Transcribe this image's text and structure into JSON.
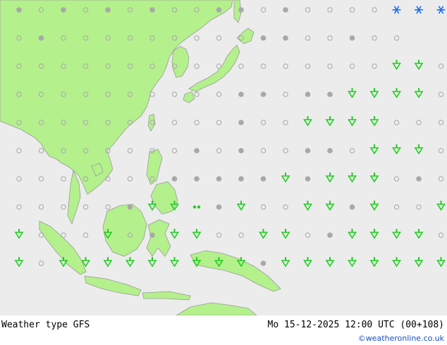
{
  "footer": {
    "left_label": "Weather type  GFS",
    "right_label": "Mo 15-12-2025 12:00 UTC (00+108)",
    "credit": "©weatheronline.co.uk"
  },
  "colors": {
    "sea": "#ececec",
    "land": "#b4f08c",
    "coast": "#9a9a9a",
    "rain": "#22cc22",
    "snow": "#1e6ef0",
    "cloud": "#a8a8a8"
  },
  "grid_symbols": [
    "cpcpcpcppccpcppppsssrrcpccp",
    "pcpppppppppccppcpp",
    "ppppppppppppppppprrpppppppp",
    "ppppppppppccpccrrrrppprrrp",
    "ppppppppppcpprrrrppprrrrr",
    "ppppppppcpcppccprrrpprrrr",
    "pppppppcccccrcrrrpcpdrrp",
    "pppppcrrdcrpprrcrpprrrr",
    "rppprpcrrpprrpcrrrrprrrrc",
    "rprrrrrrrrrcrrrrrrrrrrrr"
  ]
}
